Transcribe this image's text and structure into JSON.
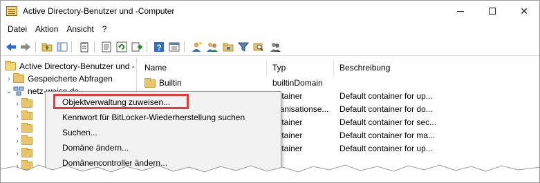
{
  "window": {
    "title": "Active Directory-Benutzer und -Computer",
    "controls": {
      "minimize": "—",
      "maximize": "☐",
      "close": "✕"
    }
  },
  "menubar": {
    "items": [
      "Datei",
      "Aktion",
      "Ansicht",
      "?"
    ]
  },
  "toolbar": {
    "icons": [
      "back-arrow-icon",
      "forward-arrow-icon",
      "up-folder-icon",
      "show-hide-tree-icon",
      "clipboard-icon",
      "properties-icon",
      "refresh-icon",
      "export-list-icon",
      "help-icon",
      "console-icon",
      "new-user-icon",
      "new-group-icon",
      "new-ou-icon",
      "filter-icon",
      "find-icon",
      "add-to-group-icon"
    ]
  },
  "tree": {
    "root": "Active Directory-Benutzer und -",
    "saved_queries": "Gespeicherte Abfragen",
    "domain": "netz-weise.de"
  },
  "list": {
    "columns": [
      "Name",
      "Typ",
      "Beschreibung"
    ],
    "rows": [
      {
        "name": "Builtin",
        "type": "builtinDomain",
        "description": ""
      },
      {
        "name": "",
        "type": "ontainer",
        "description": "Default container for up..."
      },
      {
        "name": "",
        "type": "rganisationse...",
        "description": "Default container for do..."
      },
      {
        "name": "",
        "type": "ontainer",
        "description": "Default container for sec..."
      },
      {
        "name": "",
        "type": "ontainer",
        "description": "Default container for ma..."
      },
      {
        "name": "",
        "type": "ontainer",
        "description": "Default container for up..."
      }
    ]
  },
  "context_menu": {
    "items": [
      "Objektverwaltung zuweisen...",
      "Kennwort für BitLocker-Wiederherstellung suchen",
      "Suchen...",
      "Domäne ändern...",
      "Domänencontroller ändern..."
    ],
    "highlighted_index": 0
  },
  "colors": {
    "highlight_border": "#e03a3a",
    "folder": "#e8c46a",
    "toolbar_blue": "#2a6ccf"
  }
}
